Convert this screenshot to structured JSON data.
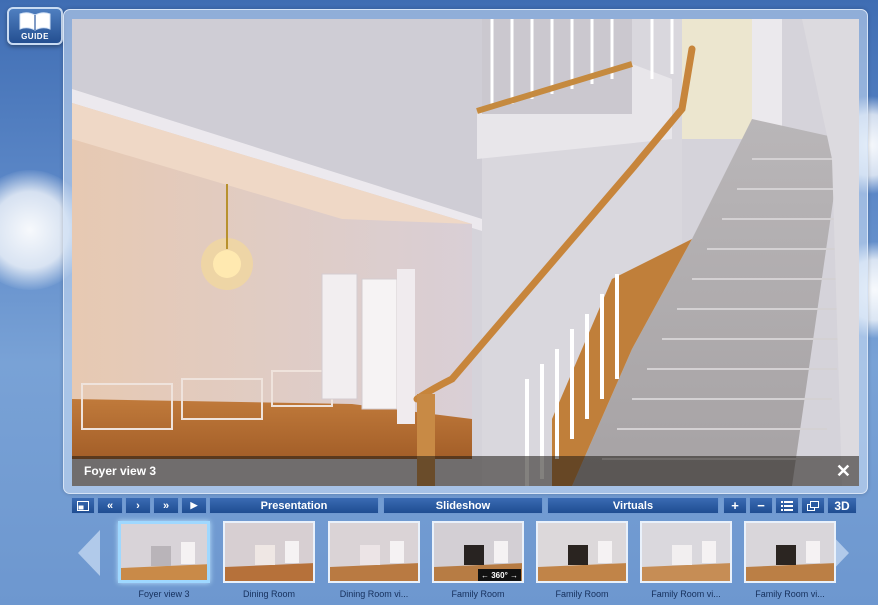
{
  "guide": {
    "label": "GUIDE"
  },
  "viewer": {
    "caption": "Foyer view 3",
    "close_symbol": "✕"
  },
  "toolbar": {
    "first_symbol": "«",
    "prev_symbol": "‹",
    "next_symbol": "›",
    "last_symbol": "»",
    "play_symbol": "▶",
    "presentation": "Presentation",
    "slideshow": "Slideshow",
    "virtuals": "Virtuals",
    "zoom_in": "+",
    "zoom_out": "−",
    "three_d": "3D"
  },
  "thumbnails": [
    {
      "label": "Foyer view 3",
      "active": true
    },
    {
      "label": "Dining Room"
    },
    {
      "label": "Dining Room vi..."
    },
    {
      "label": "Family Room",
      "badge": "← 360° →"
    },
    {
      "label": "Family Room"
    },
    {
      "label": "Family Room vi..."
    },
    {
      "label": "Family Room vi..."
    }
  ],
  "colors": {
    "accent": "#1f4d92",
    "active_border": "#9fd8ff"
  }
}
